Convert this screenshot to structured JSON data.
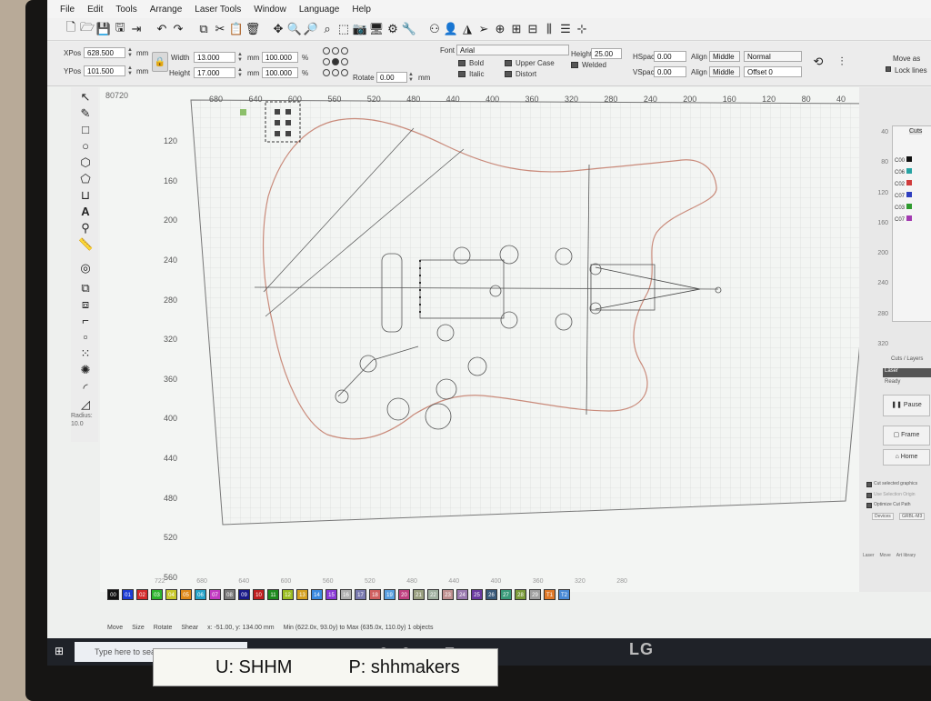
{
  "menubar": {
    "items": [
      "File",
      "Edit",
      "Tools",
      "Arrange",
      "Laser Tools",
      "Window",
      "Language",
      "Help"
    ]
  },
  "position": {
    "xpos_label": "XPos",
    "xpos_value": "628.500",
    "ypos_label": "YPos",
    "ypos_value": "101.500",
    "unit": "mm"
  },
  "size": {
    "width_label": "Width",
    "width_value": "13.000",
    "height_label": "Height",
    "height_value": "17.000",
    "unit": "mm",
    "width_pct": "100.000",
    "height_pct": "100.000",
    "pct_unit": "%"
  },
  "rotate": {
    "label": "Rotate",
    "value": "0.00",
    "unit": "mm"
  },
  "text_props": {
    "font_label": "Font",
    "font_value": "Arial",
    "height_label": "Height",
    "height_value": "25.00",
    "hspace_label": "HSpace",
    "hspace_value": "0.00",
    "vspace_label": "VSpace",
    "vspace_value": "0.00",
    "alignx_label": "Align X",
    "alignx_value": "Middle",
    "aligny_label": "Align Y",
    "aligny_value": "Middle",
    "style_value": "Normal",
    "offset_value": "Offset 0",
    "bold": "Bold",
    "italic": "Italic",
    "upper_case": "Upper Case",
    "distort": "Distort",
    "welded": "Welded"
  },
  "move_as": {
    "move_label": "Move as",
    "lock_label": "Lock lines"
  },
  "left_tools": {
    "radius_label": "Radius:",
    "radius_value": "10.0"
  },
  "ruler": {
    "corner": "80720",
    "top": [
      "680",
      "640",
      "600",
      "560",
      "520",
      "480",
      "440",
      "400",
      "360",
      "320",
      "280",
      "240",
      "200",
      "160",
      "120",
      "80",
      "40"
    ],
    "left": [
      "120",
      "160",
      "200",
      "240",
      "280",
      "320",
      "360",
      "400",
      "440",
      "480",
      "520",
      "560"
    ],
    "bottom": [
      "722",
      "680",
      "640",
      "600",
      "560",
      "520",
      "480",
      "440",
      "400",
      "360",
      "320",
      "280"
    ]
  },
  "right_panel": {
    "tab": "Cuts",
    "ruler": [
      "40",
      "80",
      "120",
      "160",
      "200",
      "240",
      "280",
      "320"
    ],
    "layers": [
      "C00",
      "C06",
      "C02",
      "C07",
      "C03",
      "C07"
    ],
    "layer_colors": [
      "#111111",
      "#27a3a3",
      "#d03b3b",
      "#2f3fbf",
      "#2f9a2f",
      "#a23ab0"
    ],
    "tabs2": "Cuts / Layers",
    "laser_tab": "Laser",
    "ready": "Ready",
    "pause": "Pause",
    "frame": "Frame",
    "home": "Home",
    "cut_selected": "Cut selected graphics",
    "use_selection": "Use Selection Origin",
    "optimize": "Optimize Cut Path",
    "devices": "Devices",
    "device_name": "GRBL-M3",
    "bottom_tabs": [
      "Laser",
      "Move",
      "Art library"
    ]
  },
  "palette": {
    "labels": [
      "00",
      "01",
      "02",
      "03",
      "04",
      "05",
      "06",
      "07",
      "08",
      "09",
      "10",
      "11",
      "12",
      "13",
      "14",
      "15",
      "16",
      "17",
      "18",
      "19",
      "20",
      "21",
      "22",
      "23",
      "24",
      "25",
      "26",
      "27",
      "28",
      "29",
      "T1",
      "T2"
    ],
    "colors": [
      "#111111",
      "#1c3cd6",
      "#d42a2a",
      "#2fb52f",
      "#c8c82a",
      "#e08a1a",
      "#27a3c8",
      "#c23ac2",
      "#7c7c7c",
      "#1a1a8a",
      "#c02020",
      "#1e8a1e",
      "#9bbd22",
      "#d4a020",
      "#3a8ae0",
      "#8a3ad6",
      "#b0b0b0",
      "#7a7ab0",
      "#d06060",
      "#5aa0e0",
      "#c04080",
      "#9aa080",
      "#a0b0a0",
      "#c09090",
      "#9a7ab0",
      "#6a3aa0",
      "#3a5a7a",
      "#3a9a7a",
      "#7a9a3a",
      "#a0a0a0",
      "#e07a2a",
      "#4a8ad6"
    ]
  },
  "status": {
    "move": "Move",
    "size": "Size",
    "rotate": "Rotate",
    "shear": "Shear",
    "coords": "x: -51.00, y: 134.00 mm",
    "minmax": "Min (622.0x, 93.0y) to Max (635.0x, 110.0y)   1 objects"
  },
  "taskbar": {
    "search_placeholder": "Type here to search"
  },
  "credentials": {
    "user": "U: SHHM",
    "password": "P: shhmakers"
  },
  "monitor_brand": "LG"
}
